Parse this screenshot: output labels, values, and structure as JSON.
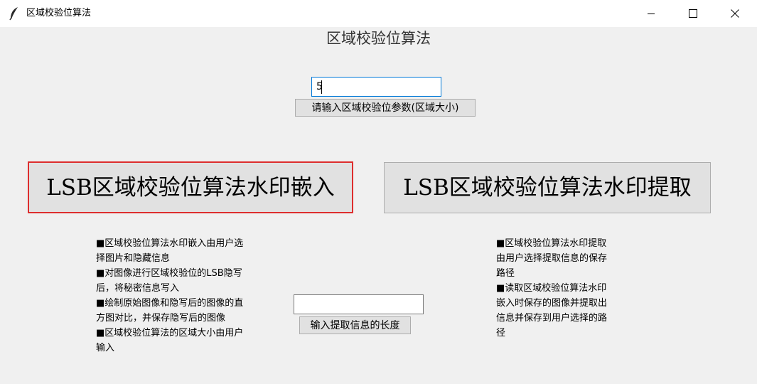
{
  "window": {
    "title": "区域校验位算法",
    "icon": "feather-icon",
    "controls": [
      "minimize-icon",
      "maximize-icon",
      "close-icon"
    ]
  },
  "heading": "区域校验位算法",
  "param_input": {
    "value": "5"
  },
  "param_button": "请输入区域校验位参数(区域大小)",
  "embed_button": "LSB区域校验位算法水印嵌入",
  "extract_button": "LSB区域校验位算法水印提取",
  "embed_description": [
    "■区域校验位算法水印嵌入由用户选",
    "择图片和隐藏信息",
    "■对图像进行区域校验位的LSB隐写",
    "后，将秘密信息写入",
    "■绘制原始图像和隐写后的图像的直",
    "方图对比，并保存隐写后的图像",
    "■区域校验位算法的区域大小由用户",
    "输入"
  ],
  "extract_description": [
    "■区域校验位算法水印提取",
    "由用户选择提取信息的保存",
    "路径",
    "■读取区域校验位算法水印",
    "嵌入时保存的图像并提取出",
    "信息并保存到用户选择的路",
    "径"
  ],
  "length_input": {
    "value": ""
  },
  "length_button": "输入提取信息的长度",
  "colors": {
    "background": "#f0f0f0",
    "button_face": "#e1e1e1",
    "focus_border": "#dd2e2e",
    "input_focus": "#0078d7"
  }
}
